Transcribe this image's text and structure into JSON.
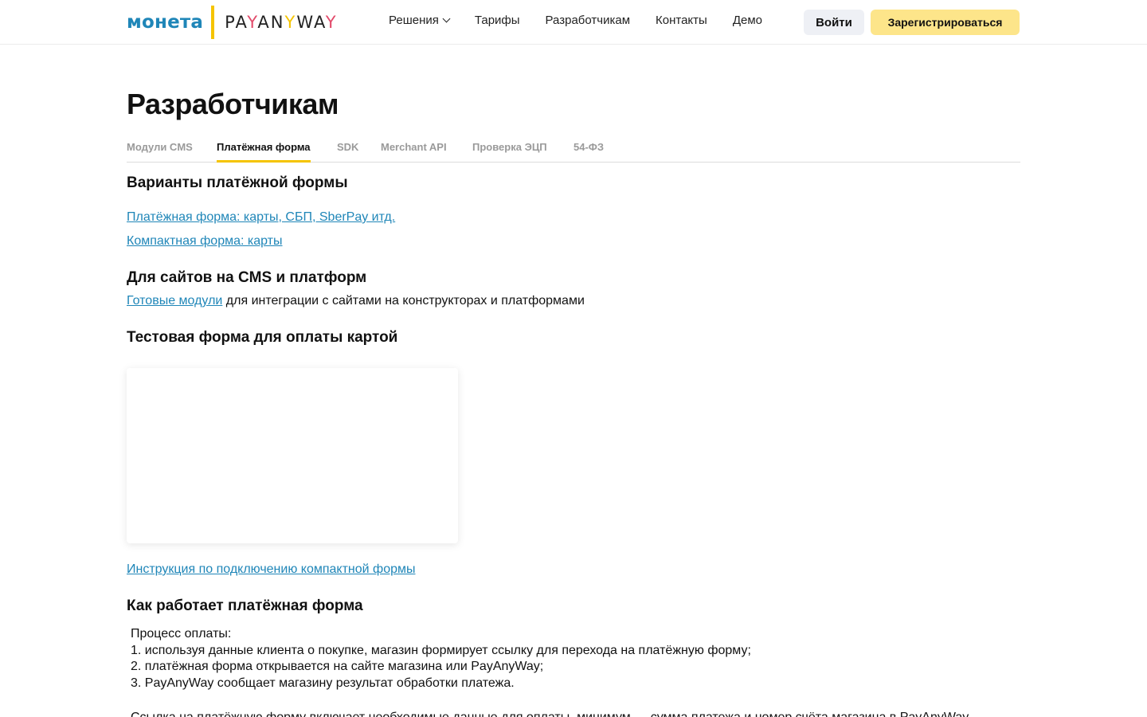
{
  "header": {
    "logo": {
      "left": "монета",
      "right": "PAYANYWAY"
    },
    "nav": [
      {
        "label": "Решения",
        "has_dropdown": true
      },
      {
        "label": "Тарифы"
      },
      {
        "label": "Разработчикам"
      },
      {
        "label": "Контакты"
      },
      {
        "label": "Демо"
      }
    ],
    "login_label": "Войти",
    "register_label": "Зарегистрироваться"
  },
  "page": {
    "title": "Разработчикам",
    "tabs": [
      "Модули CMS",
      "Платёжная форма",
      "SDK",
      "Merchant API",
      "Проверка ЭЦП",
      "54-ФЗ"
    ],
    "active_tab": "Платёжная форма"
  },
  "sections": {
    "variants": {
      "heading": "Варианты платёжной формы",
      "links": [
        "Платёжная форма: карты, СБП, SberPay итд.",
        "Компактная форма: карты"
      ]
    },
    "cms": {
      "heading": "Для сайтов на CMS и платформ",
      "link": "Готовые модули",
      "text": " для интеграции с сайтами на конструкторах и платформами"
    },
    "test_form": {
      "heading": "Тестовая форма для оплаты картой",
      "instruction_link": "Инструкция по подключению компактной формы"
    },
    "how_it_works": {
      "heading": "Как работает платёжная форма",
      "lines": [
        "Процесс оплаты:",
        "1. используя данные клиента о покупке, магазин формирует ссылку для перехода на платёжную форму;",
        "2. платёжная форма открывается на сайте магазина или PayAnyWay;",
        "3. PayAnyWay сообщает магазину результат обработки платежа."
      ],
      "partial_line": "Ссылка на платёжную форму включает необходимые данные для оплаты, минимум — сумма платежа и номер счёта магазина в PayAnyWay"
    }
  },
  "colors": {
    "brand_blue": "#1f86b8",
    "brand_yellow": "#f5c400",
    "register_bg": "#fde58a",
    "login_bg": "#eef0f5",
    "link": "#1f86b8"
  }
}
